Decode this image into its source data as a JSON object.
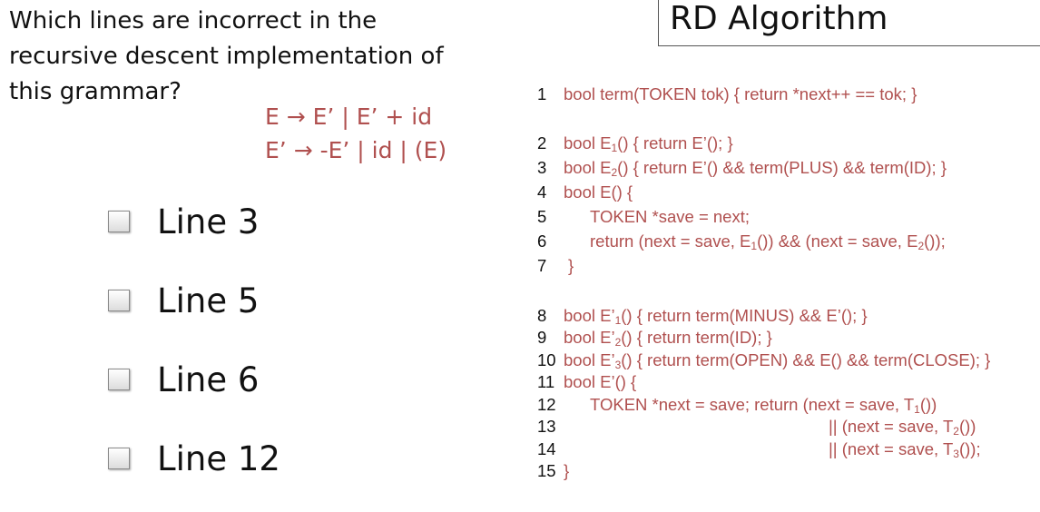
{
  "question": {
    "line1": "Which lines are incorrect in the",
    "line2": "recursive descent implementation of",
    "line3": "this grammar?"
  },
  "grammar": {
    "rule1": "E → E’ | E’ + id",
    "rule2": "E’ → -E’ | id | (E)"
  },
  "options": [
    {
      "label": "Line 3",
      "checked": false
    },
    {
      "label": "Line 5",
      "checked": false
    },
    {
      "label": "Line 6",
      "checked": false
    },
    {
      "label": "Line 12",
      "checked": false
    }
  ],
  "title": "RD Algorithm",
  "code": {
    "l1": {
      "num": "1",
      "text": "bool term(TOKEN tok) { return *next++ == tok; }"
    },
    "l2": {
      "num": "2",
      "a": "bool E",
      "s": "1",
      "b": "() { return E’(); }"
    },
    "l3": {
      "num": "3",
      "a": "bool E",
      "s": "2",
      "b": "() { return E’() && term(PLUS) && term(ID); }"
    },
    "l4": {
      "num": "4",
      "text": "bool E() {"
    },
    "l5": {
      "num": "5",
      "text": "TOKEN *save = next;"
    },
    "l6": {
      "num": "6",
      "a": "return (next = save, E",
      "s1": "1",
      "b": "()) && (next = save,  E",
      "s2": "2",
      "c": "());"
    },
    "l7": {
      "num": "7",
      "text": "}"
    },
    "l8": {
      "num": "8",
      "a": "bool E’",
      "s": "1",
      "b": "() { return term(MINUS) && E’(); }"
    },
    "l9": {
      "num": "9",
      "a": "bool E’",
      "s": "2",
      "b": "() { return term(ID); }"
    },
    "l10": {
      "num": "10",
      "a": "bool E’",
      "s": "3",
      "b": "() { return term(OPEN) && E() && term(CLOSE); }"
    },
    "l11": {
      "num": "11",
      "text": "bool E’() {"
    },
    "l12": {
      "num": "12",
      "a": "TOKEN *next = save;  return (next = save, T",
      "s": "1",
      "b": "())"
    },
    "l13": {
      "num": "13",
      "a": "|| (next = save,  T",
      "s": "2",
      "b": "())"
    },
    "l14": {
      "num": "14",
      "a": "|| (next = save,  T",
      "s": "3",
      "b": "());"
    },
    "l15": {
      "num": "15",
      "text": "}"
    }
  },
  "colors": {
    "code_text": "#b0504f",
    "body_text": "#111111"
  }
}
